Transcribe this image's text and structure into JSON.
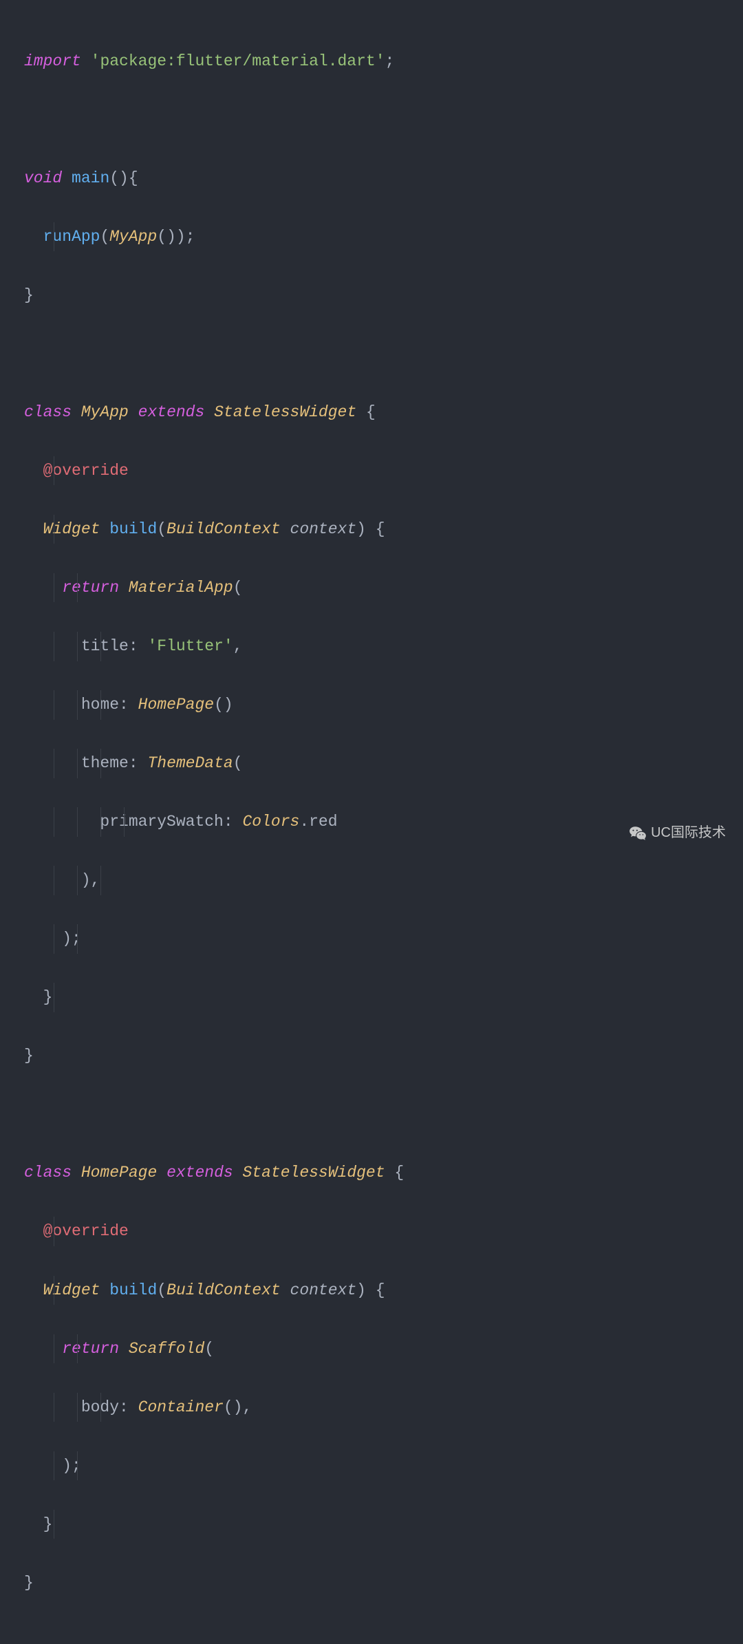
{
  "code": {
    "l1_import": "import",
    "l1_pkg": "'package:flutter/material.dart'",
    "l1_semi": ";",
    "l3_void": "void",
    "l3_main": "main",
    "l3_paren": "(){",
    "l4_runApp": "runApp",
    "l4_open": "(",
    "l4_MyApp": "MyApp",
    "l4_close": "());",
    "l5_brace": "}",
    "l7_class": "class",
    "l7_MyApp": "MyApp",
    "l7_extends": "extends",
    "l7_Stateless": "StatelessWidget",
    "l7_brace": " {",
    "l8_at": "@",
    "l8_override": "override",
    "l9_Widget": "Widget",
    "l9_build": "build",
    "l9_open": "(",
    "l9_BuildContext": "BuildContext",
    "l9_context": " context",
    "l9_close": ") {",
    "l10_return": "return",
    "l10_MaterialApp": "MaterialApp",
    "l10_open": "(",
    "l11_title": "title",
    "l11_colon": ":",
    "l11_flutter": "'Flutter'",
    "l11_comma": ",",
    "l12_home": "home",
    "l12_colon": ":",
    "l12_HomePage": "HomePage",
    "l12_paren": "()",
    "l13_theme": "theme",
    "l13_colon": ":",
    "l13_ThemeData": "ThemeData",
    "l13_open": "(",
    "l14_primary": "primarySwatch",
    "l14_colon": ":",
    "l14_Colors": "Colors",
    "l14_dot": ".",
    "l14_red": "red",
    "l15_close": "),",
    "l16_close": ");",
    "l17_brace": "}",
    "l18_brace": "}",
    "l20_class": "class",
    "l20_HomePage": "HomePage",
    "l20_extends": "extends",
    "l20_Stateless": "StatelessWidget",
    "l20_brace": " {",
    "l21_at": "@",
    "l21_override": "override",
    "l22_Widget": "Widget",
    "l22_build": "build",
    "l22_open": "(",
    "l22_BuildContext": "BuildContext",
    "l22_context": " context",
    "l22_close": ") {",
    "l23_return": "return",
    "l23_Scaffold": "Scaffold",
    "l23_open": "(",
    "l24_body": "body",
    "l24_colon": ":",
    "l24_Container": "Container",
    "l24_paren": "(),",
    "l25_close": ");",
    "l26_brace": "}",
    "l27_brace": "}"
  },
  "watermark": "UC国际技术"
}
